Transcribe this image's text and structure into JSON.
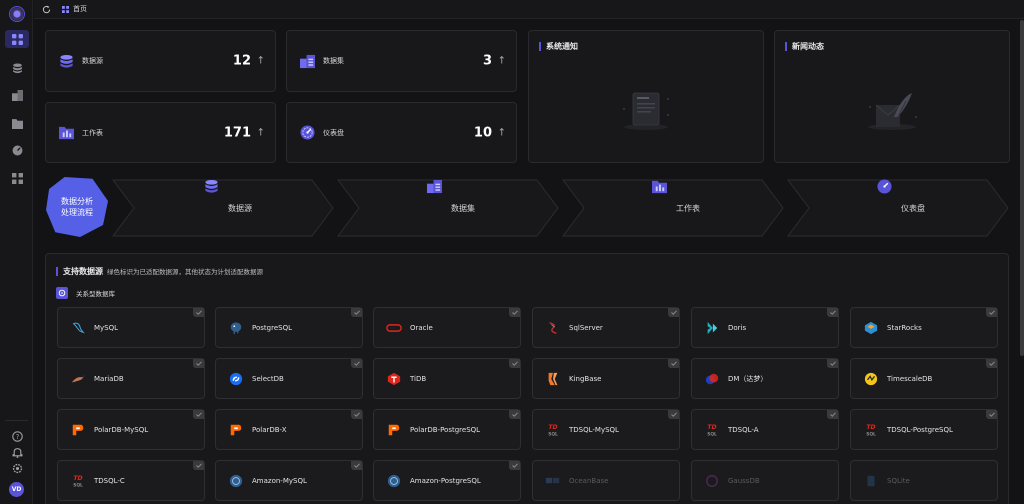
{
  "topbar": {
    "breadcrumb": "首页"
  },
  "stats": [
    {
      "label": "数据源",
      "value": "12",
      "icon": "database-icon"
    },
    {
      "label": "数据集",
      "value": "3",
      "icon": "dataset-icon"
    },
    {
      "label": "工作表",
      "value": "171",
      "icon": "worksheet-icon"
    },
    {
      "label": "仪表盘",
      "value": "10",
      "icon": "dashboard-icon"
    }
  ],
  "stat_arrow": "↑",
  "panels": {
    "notice_title": "系统通知",
    "news_title": "新闻动态"
  },
  "flow": {
    "badge_line1": "数据分析",
    "badge_line2": "处理流程",
    "steps": [
      "数据源",
      "数据集",
      "工作表",
      "仪表盘"
    ]
  },
  "support": {
    "title": "支持数据源",
    "desc": "绿色标识为已适配数据源，其他状态为计划适配数据源",
    "category": "关系型数据库",
    "items": [
      "MySQL",
      "PostgreSQL",
      "Oracle",
      "SqlServer",
      "Doris",
      "StarRocks",
      "MariaDB",
      "SelectDB",
      "TiDB",
      "KingBase",
      "DM（达梦）",
      "TimescaleDB",
      "PolarDB-MySQL",
      "PolarDB-X",
      "PolarDB-PostgreSQL",
      "TDSQL-MySQL",
      "TDSQL-A",
      "TDSQL-PostgreSQL",
      "TDSQL-C",
      "Amazon-MySQL",
      "Amazon-PostgreSQL",
      "OceanBase",
      "GaussDB",
      "SQLite"
    ]
  },
  "user": {
    "avatar": "VD"
  },
  "colors": {
    "accent": "#5a55d8",
    "background": "#131316",
    "card": "#18181b"
  }
}
